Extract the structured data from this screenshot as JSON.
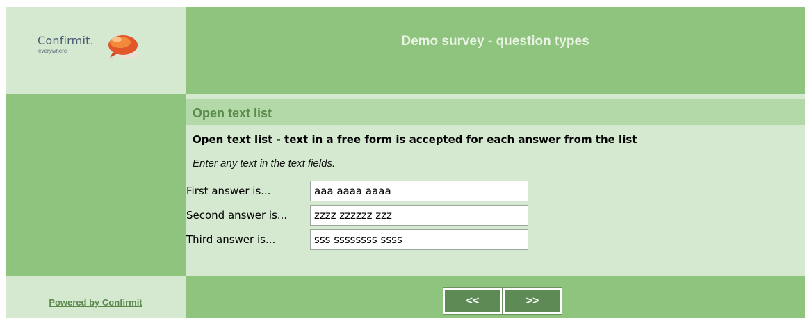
{
  "header": {
    "title": "Demo survey - question types",
    "logo": {
      "word": "Confirmit.",
      "tagline": "everywhere",
      "icon": "speech-bubble-icon"
    }
  },
  "question": {
    "heading": "Open text list",
    "text": "Open text list - text in a free form is accepted for each answer from the list",
    "instruction": "Enter any text in the text fields.",
    "answers": [
      {
        "label": "First answer is...",
        "value": "aaa aaaa aaaa"
      },
      {
        "label": "Second answer is...",
        "value": "zzzz zzzzzz zzz"
      },
      {
        "label": "Third answer is...",
        "value": "sss ssssssss ssss"
      }
    ]
  },
  "footer": {
    "powered_by": "Powered by Confirmit",
    "prev_label": "<<",
    "next_label": ">>"
  },
  "colors": {
    "dark_green": "#8fc47f",
    "light_green": "#d5e8d0",
    "mid_green": "#b4d9a8",
    "button_green": "#5e8a55",
    "title_green": "#5a8a4c"
  }
}
